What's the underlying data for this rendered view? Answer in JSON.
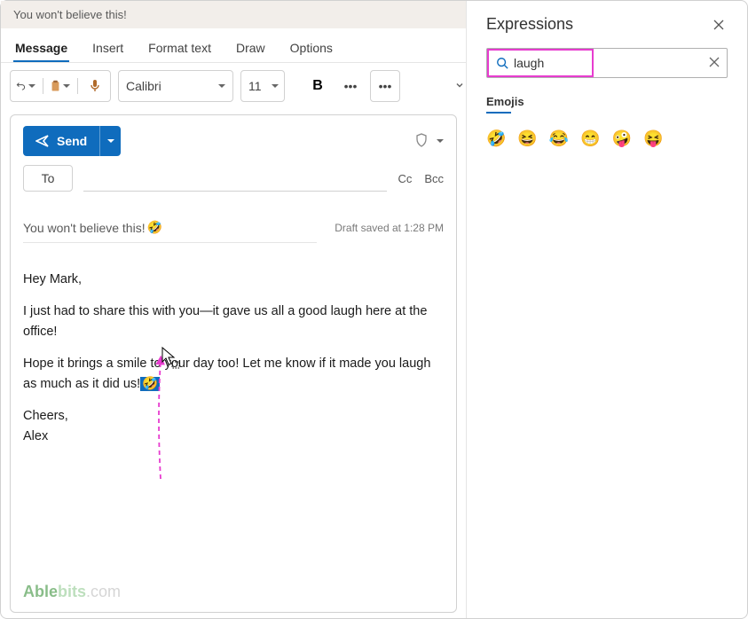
{
  "window": {
    "title": "You won't believe this!"
  },
  "tabs": {
    "items": [
      "Message",
      "Insert",
      "Format text",
      "Draw",
      "Options"
    ],
    "active": 0
  },
  "toolbar": {
    "font": "Calibri",
    "size": "11",
    "bold": "B"
  },
  "compose": {
    "send_label": "Send",
    "to_label": "To",
    "cc": "Cc",
    "bcc": "Bcc",
    "subject": "You won't believe this!",
    "subject_emoji": "🤣",
    "draft_status": "Draft saved at 1:28 PM",
    "body": {
      "greeting": "Hey Mark,",
      "p1": "I just had to share this with you—it gave us all a good laugh here at the office!",
      "p2a": "Hope it brings a smile to your day too! Let me know if it made you laugh as much as it did us!",
      "p2_emoji": "🤣",
      "signoff": "Cheers,",
      "name": "Alex"
    }
  },
  "watermark": {
    "a": "Able",
    "b": "bits",
    "c": ".com"
  },
  "expressions": {
    "title": "Expressions",
    "search": "laugh",
    "section": "Emojis",
    "items": [
      "🤣",
      "😆",
      "😂",
      "😁",
      "🤪",
      "😝"
    ]
  }
}
